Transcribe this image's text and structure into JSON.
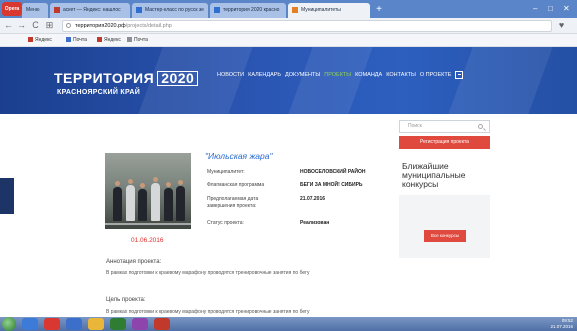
{
  "browser": {
    "logo_label": "Opera",
    "tabs": [
      {
        "label": "Меню",
        "favicon": "opera"
      },
      {
        "label": "аскет — Яндекс: нашлос",
        "favicon": "yandex"
      },
      {
        "label": "Мастер-класс по русск зе",
        "favicon": "blue"
      },
      {
        "label": "территория 2020 красно",
        "favicon": "blue"
      },
      {
        "label": "Муниципалитеты",
        "favicon": "orange"
      }
    ],
    "new_tab_symbol": "+",
    "window_controls": [
      "–",
      "□",
      "✕"
    ],
    "url_host": "территория2020.рф",
    "url_path": "/projects/detail.php",
    "back_symbol": "←",
    "forward_symbol": "→",
    "reload_symbol": "C",
    "home_symbol": "⊞",
    "bookmarks": [
      "Яндекс",
      "Почта",
      "Яндекс",
      "Почта"
    ]
  },
  "site": {
    "logo_word": "ТЕРРИТОРИЯ",
    "logo_year": "2020",
    "logo_subtitle": "КРАСНОЯРСКИЙ КРАЙ",
    "nav": [
      {
        "label": "НОВОСТИ",
        "active": false
      },
      {
        "label": "КАЛЕНДАРЬ",
        "active": false
      },
      {
        "label": "ДОКУМЕНТЫ",
        "active": false
      },
      {
        "label": "ПРОЕКТЫ",
        "active": true
      },
      {
        "label": "КОМАНДА",
        "active": false
      },
      {
        "label": "КОНТАКТЫ",
        "active": false
      },
      {
        "label": "О ПРОЕКТЕ",
        "active": false
      }
    ]
  },
  "project": {
    "title": "\"Июльская жара\"",
    "date": "01.06.2016",
    "fields": [
      {
        "label": "Муниципалитет:",
        "value": "НОВОСЕЛОВСКИЙ РАЙОН"
      },
      {
        "label": "Флагманская программа",
        "value": "БЕГИ ЗА МНОЙ! СИБИРЬ"
      },
      {
        "label": "Предполагаемая дата завершения проекта:",
        "value": "21.07.2016"
      },
      {
        "label": "Статус проекта:",
        "value": "Реализован"
      }
    ],
    "annotation_label": "Аннотация проекта:",
    "annotation_text": "В рамках подготовки к краевому марафону проводятся тренировочные занятия по бегу",
    "goal_label": "Цель проекта:",
    "goal_text": "В рамках подготовки к краевому марафону проводятся тренировочные занятия по бегу"
  },
  "sidebar": {
    "search_placeholder": "Поиск",
    "register_button": "Регистрация проекта",
    "heading": "Ближайшие муниципальные конкурсы",
    "all_contests_button": "Все конкурсы"
  },
  "taskbar": {
    "tray_time": "09:52",
    "tray_date": "21.07.2016"
  },
  "colors": {
    "header_blue": "#2b56b3",
    "nav_active": "#8fd14f",
    "accent_red": "#e04a3e",
    "title_blue": "#2a6bd1",
    "date_red": "#d9302c"
  }
}
